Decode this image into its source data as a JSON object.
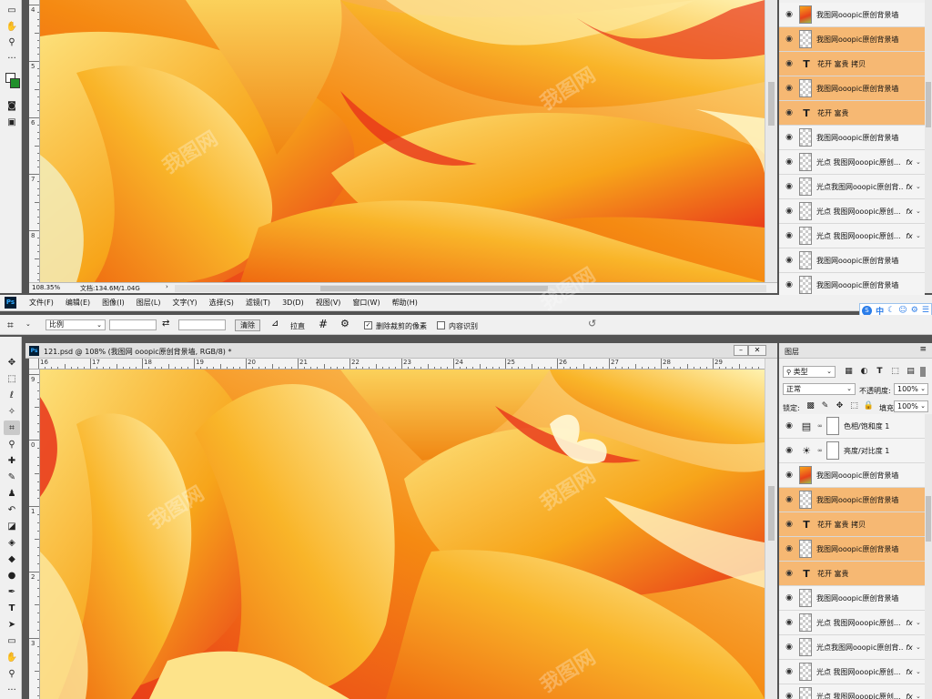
{
  "top_window": {
    "status_zoom": "108.35%",
    "status_doc": "文档:134.6M/1.04G",
    "vruler": [
      "4",
      "5",
      "6",
      "7",
      "8"
    ],
    "layers": [
      {
        "name": "我图网ooopic原创背景墙",
        "thumb": "image",
        "selected": false,
        "fx": false
      },
      {
        "name": "我图网ooopic原创背景墙",
        "thumb": "checker",
        "selected": true,
        "fx": false
      },
      {
        "name": "花开 富贵 拷贝",
        "thumb": "text",
        "selected": true,
        "fx": false
      },
      {
        "name": "我图网ooopic原创背景墙",
        "thumb": "checker",
        "selected": true,
        "fx": false
      },
      {
        "name": "花开 富贵",
        "thumb": "text",
        "selected": true,
        "fx": false
      },
      {
        "name": "我图网ooopic原创背景墙",
        "thumb": "checker",
        "selected": false,
        "fx": false
      },
      {
        "name": "光点 我图网ooopic原创...",
        "thumb": "checker",
        "selected": false,
        "fx": true
      },
      {
        "name": "光点我图网ooopic原创背...",
        "thumb": "checker",
        "selected": false,
        "fx": true
      },
      {
        "name": "光点 我图网ooopic原创...",
        "thumb": "checker",
        "selected": false,
        "fx": true
      },
      {
        "name": "光点 我图网ooopic原创...",
        "thumb": "checker",
        "selected": false,
        "fx": true
      },
      {
        "name": "我图网ooopic原创背景墙",
        "thumb": "checker",
        "selected": false,
        "fx": false
      },
      {
        "name": "我图网ooopic原创背景墙",
        "thumb": "checker",
        "selected": false,
        "fx": false
      }
    ]
  },
  "menubar": {
    "app_icon": "Ps",
    "items": [
      "文件(F)",
      "编辑(E)",
      "图像(I)",
      "图层(L)",
      "文字(Y)",
      "选择(S)",
      "滤镜(T)",
      "3D(D)",
      "视图(V)",
      "窗口(W)",
      "帮助(H)"
    ]
  },
  "ime": {
    "lang": "中",
    "icons": [
      "ime-s-icon",
      "moon-icon",
      "smile-icon",
      "settings-icon",
      "menu-icon"
    ]
  },
  "options": {
    "ratio_label": "比例",
    "clear": "清除",
    "straighten": "拉直",
    "delete_cropped": "删除裁剪的像素",
    "content_aware": "内容识别"
  },
  "document": {
    "tab_title": "121.psd @ 108% (我图网 ooopic原创背景墙, RGB/8) *",
    "hruler": [
      "16",
      "17",
      "18",
      "19",
      "20",
      "21",
      "22",
      "23",
      "24",
      "25",
      "26",
      "27",
      "28",
      "29"
    ],
    "vruler": [
      "9",
      "0",
      "1",
      "2",
      "3"
    ]
  },
  "layers_panel": {
    "title": "图层",
    "filter": "类型",
    "blend": "正常",
    "opacity_label": "不透明度:",
    "opacity": "100%",
    "lock_label": "锁定:",
    "fill_label": "填充:",
    "fill": "100%",
    "layers": [
      {
        "name": "色相/饱和度 1",
        "thumb": "hue",
        "selected": false,
        "fx": false
      },
      {
        "name": "亮度/对比度 1",
        "thumb": "bright",
        "selected": false,
        "fx": false
      },
      {
        "name": "我图网ooopic原创背景墙",
        "thumb": "image",
        "selected": false,
        "fx": false
      },
      {
        "name": "我图网ooopic原创背景墙",
        "thumb": "checker",
        "selected": true,
        "fx": false
      },
      {
        "name": "花开 富贵 拷贝",
        "thumb": "text",
        "selected": true,
        "fx": false
      },
      {
        "name": "我图网ooopic原创背景墙",
        "thumb": "checker",
        "selected": true,
        "fx": false
      },
      {
        "name": "花开 富贵",
        "thumb": "text",
        "selected": true,
        "fx": false
      },
      {
        "name": "我图网ooopic原创背景墙",
        "thumb": "checker",
        "selected": false,
        "fx": false
      },
      {
        "name": "光点 我图网ooopic原创...",
        "thumb": "checker",
        "selected": false,
        "fx": true
      },
      {
        "name": "光点我图网ooopic原创背...",
        "thumb": "checker",
        "selected": false,
        "fx": true
      },
      {
        "name": "光点 我图网ooopic原创...",
        "thumb": "checker",
        "selected": false,
        "fx": true
      },
      {
        "name": "光点 我图网ooopic原创...",
        "thumb": "checker",
        "selected": false,
        "fx": true
      }
    ]
  },
  "watermark": "我图网",
  "colors": {
    "selected_layer": "#f6b873",
    "accent_orange": "#f7a51a",
    "red": "#e8341a",
    "ps_blue": "#001e36"
  }
}
